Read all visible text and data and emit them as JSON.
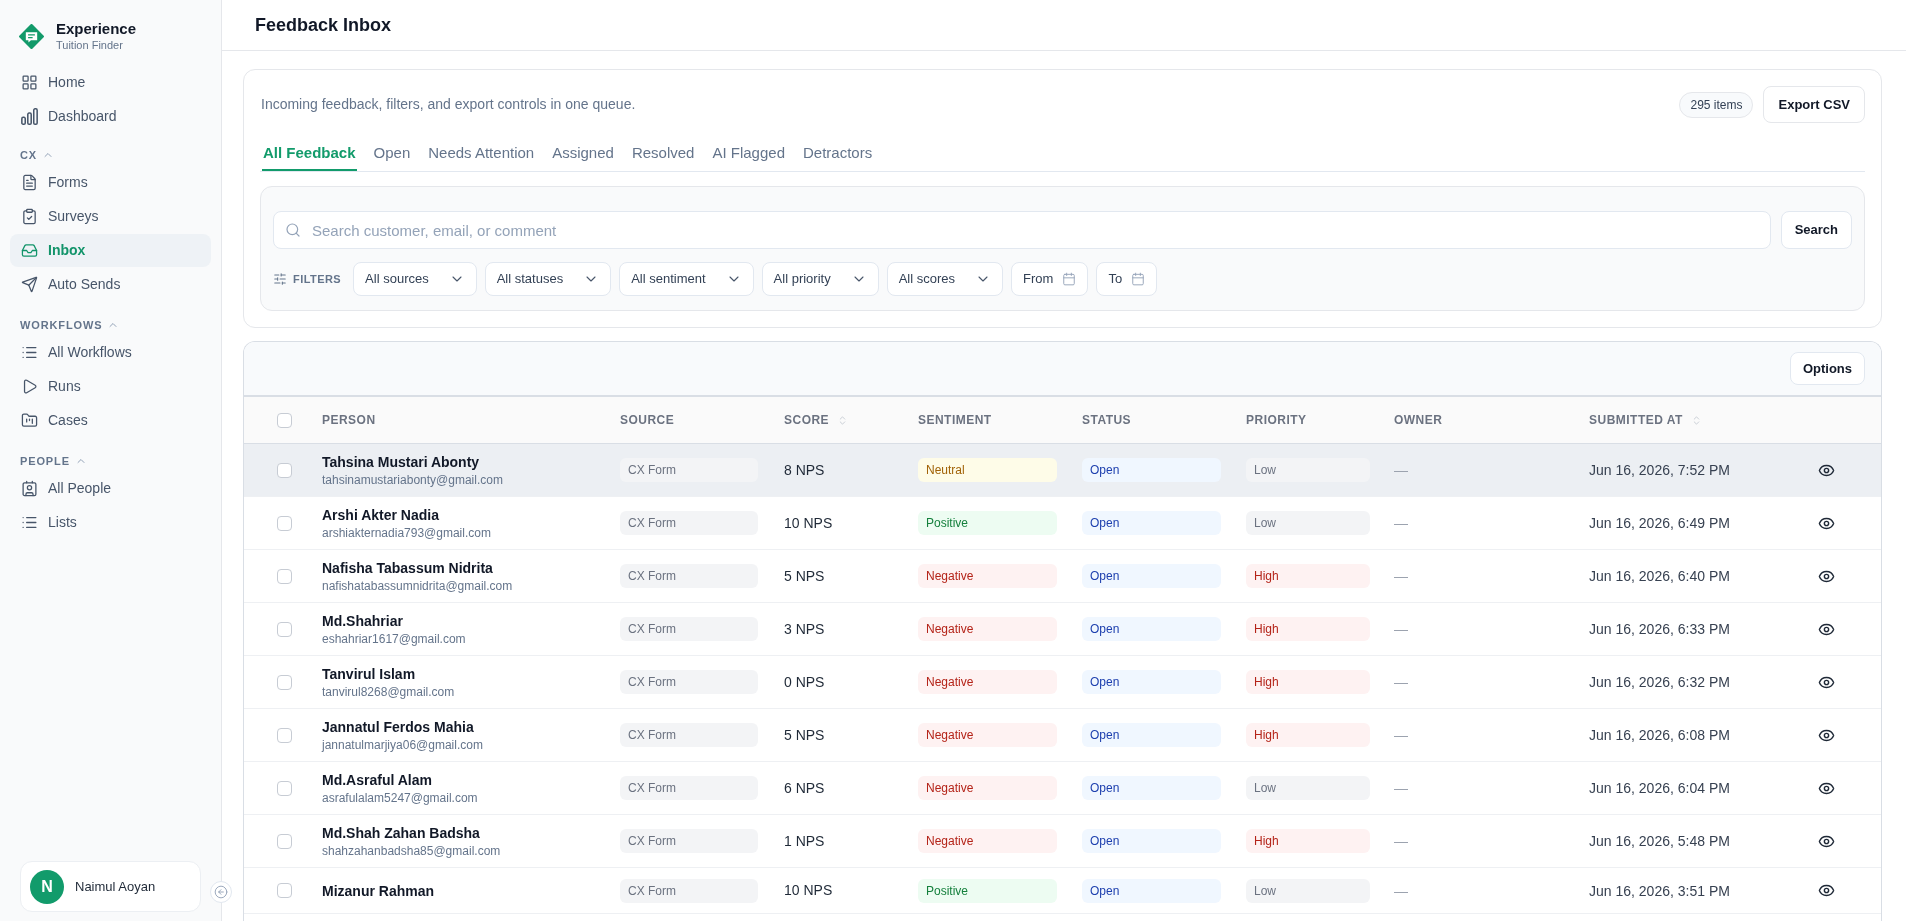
{
  "sidebar": {
    "brand": {
      "title": "Experience",
      "subtitle": "Tuition Finder"
    },
    "groups": [
      {
        "items": [
          {
            "label": "Home",
            "selected": false
          },
          {
            "label": "Dashboard",
            "selected": false
          }
        ]
      },
      {
        "label": "CX",
        "expanded": true,
        "items": [
          {
            "label": "Forms",
            "selected": false
          },
          {
            "label": "Surveys",
            "selected": false
          },
          {
            "label": "Inbox",
            "selected": true
          },
          {
            "label": "Auto Sends",
            "selected": false
          }
        ]
      },
      {
        "label": "WORKFLOWS",
        "expanded": true,
        "items": [
          {
            "label": "All Workflows",
            "selected": false
          },
          {
            "label": "Runs",
            "selected": false
          },
          {
            "label": "Cases",
            "selected": false
          }
        ]
      },
      {
        "label": "PEOPLE",
        "expanded": true,
        "items": [
          {
            "label": "All People",
            "selected": false
          },
          {
            "label": "Lists",
            "selected": false
          }
        ]
      }
    ],
    "user": {
      "initial": "N",
      "name": "Naimul Aoyan"
    }
  },
  "header": {
    "title": "Feedback Inbox"
  },
  "queue": {
    "description": "Incoming feedback, filters, and export controls in one queue.",
    "count": "295 items",
    "export_button": "Export CSV",
    "tabs": [
      {
        "label": "All Feedback",
        "selected": true
      },
      {
        "label": "Open",
        "selected": false
      },
      {
        "label": "Needs Attention",
        "selected": false
      },
      {
        "label": "Assigned",
        "selected": false
      },
      {
        "label": "Resolved",
        "selected": false
      },
      {
        "label": "AI Flagged",
        "selected": false
      },
      {
        "label": "Detractors",
        "selected": false
      }
    ],
    "search": {
      "placeholder": "Search customer, email, or comment",
      "button": "Search"
    },
    "filters_label": "FILTERS",
    "filters": [
      {
        "kind": "select",
        "label": "All sources"
      },
      {
        "kind": "select",
        "label": "All statuses"
      },
      {
        "kind": "select",
        "label": "All sentiment"
      },
      {
        "kind": "select",
        "label": "All priority"
      },
      {
        "kind": "select",
        "label": "All scores"
      },
      {
        "kind": "date",
        "label": "From"
      },
      {
        "kind": "date",
        "label": "To"
      }
    ]
  },
  "table": {
    "options_button": "Options",
    "select_all": {
      "checked": false
    },
    "columns": [
      {
        "label": "PERSON",
        "sortable": false
      },
      {
        "label": "SOURCE",
        "sortable": false
      },
      {
        "label": "SCORE",
        "sortable": true
      },
      {
        "label": "SENTIMENT",
        "sortable": false
      },
      {
        "label": "STATUS",
        "sortable": false
      },
      {
        "label": "PRIORITY",
        "sortable": false
      },
      {
        "label": "OWNER",
        "sortable": false
      },
      {
        "label": "SUBMITTED AT",
        "sortable": true
      }
    ],
    "rows": [
      {
        "checked": false,
        "hovered": true,
        "name": "Tahsina Mustari Abonty",
        "email": "tahsinamustariabonty@gmail.com",
        "source": "CX Form",
        "score": "8 NPS",
        "sentiment": {
          "label": "Neutral",
          "kind": "neutral"
        },
        "status": "Open",
        "priority": {
          "label": "Low",
          "kind": "low"
        },
        "owner": "—",
        "submitted_at": "Jun 16, 2026, 7:52 PM"
      },
      {
        "checked": false,
        "hovered": false,
        "name": "Arshi Akter Nadia",
        "email": "arshiakternadia793@gmail.com",
        "source": "CX Form",
        "score": "10 NPS",
        "sentiment": {
          "label": "Positive",
          "kind": "positive"
        },
        "status": "Open",
        "priority": {
          "label": "Low",
          "kind": "low"
        },
        "owner": "—",
        "submitted_at": "Jun 16, 2026, 6:49 PM"
      },
      {
        "checked": false,
        "hovered": false,
        "name": "Nafisha Tabassum Nidrita",
        "email": "nafishatabassumnidrita@gmail.com",
        "source": "CX Form",
        "score": "5 NPS",
        "sentiment": {
          "label": "Negative",
          "kind": "negative"
        },
        "status": "Open",
        "priority": {
          "label": "High",
          "kind": "high"
        },
        "owner": "—",
        "submitted_at": "Jun 16, 2026, 6:40 PM"
      },
      {
        "checked": false,
        "hovered": false,
        "name": "Md.Shahriar",
        "email": "eshahriar1617@gmail.com",
        "source": "CX Form",
        "score": "3 NPS",
        "sentiment": {
          "label": "Negative",
          "kind": "negative"
        },
        "status": "Open",
        "priority": {
          "label": "High",
          "kind": "high"
        },
        "owner": "—",
        "submitted_at": "Jun 16, 2026, 6:33 PM"
      },
      {
        "checked": false,
        "hovered": false,
        "name": "Tanvirul Islam",
        "email": "tanvirul8268@gmail.com",
        "source": "CX Form",
        "score": "0 NPS",
        "sentiment": {
          "label": "Negative",
          "kind": "negative"
        },
        "status": "Open",
        "priority": {
          "label": "High",
          "kind": "high"
        },
        "owner": "—",
        "submitted_at": "Jun 16, 2026, 6:32 PM"
      },
      {
        "checked": false,
        "hovered": false,
        "name": "Jannatul Ferdos Mahia",
        "email": "jannatulmarjiya06@gmail.com",
        "source": "CX Form",
        "score": "5 NPS",
        "sentiment": {
          "label": "Negative",
          "kind": "negative"
        },
        "status": "Open",
        "priority": {
          "label": "High",
          "kind": "high"
        },
        "owner": "—",
        "submitted_at": "Jun 16, 2026, 6:08 PM"
      },
      {
        "checked": false,
        "hovered": false,
        "name": "Md.Asraful Alam",
        "email": "asrafulalam5247@gmail.com",
        "source": "CX Form",
        "score": "6 NPS",
        "sentiment": {
          "label": "Negative",
          "kind": "negative"
        },
        "status": "Open",
        "priority": {
          "label": "Low",
          "kind": "low"
        },
        "owner": "—",
        "submitted_at": "Jun 16, 2026, 6:04 PM"
      },
      {
        "checked": false,
        "hovered": false,
        "name": "Md.Shah Zahan Badsha",
        "email": "shahzahanbadsha85@gmail.com",
        "source": "CX Form",
        "score": "1 NPS",
        "sentiment": {
          "label": "Negative",
          "kind": "negative"
        },
        "status": "Open",
        "priority": {
          "label": "High",
          "kind": "high"
        },
        "owner": "—",
        "submitted_at": "Jun 16, 2026, 5:48 PM"
      },
      {
        "checked": false,
        "hovered": false,
        "name": "Mizanur Rahman",
        "source": "CX Form",
        "score": "10 NPS",
        "sentiment": {
          "label": "Positive",
          "kind": "positive"
        },
        "status": "Open",
        "priority": {
          "label": "Low",
          "kind": "low"
        },
        "owner": "—",
        "submitted_at": "Jun 16, 2026, 3:51 PM"
      }
    ]
  }
}
